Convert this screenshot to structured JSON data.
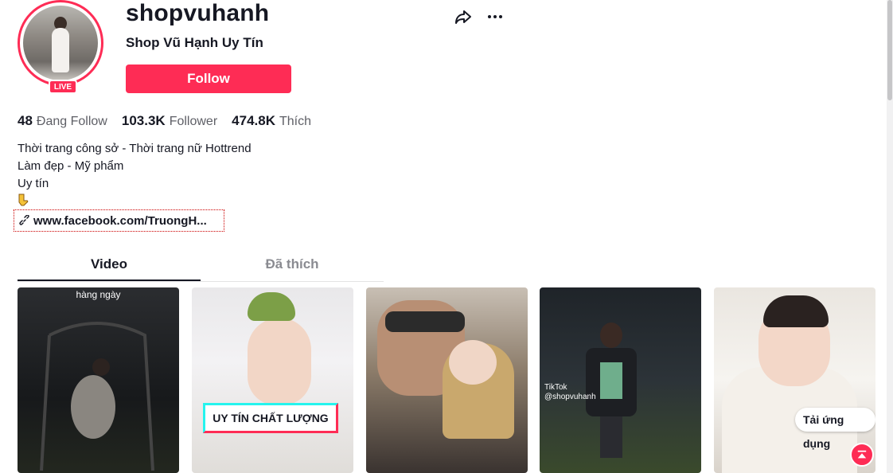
{
  "profile": {
    "username": "shopvuhanh",
    "display_name": "Shop Vũ Hạnh Uy Tín",
    "live_badge": "LIVE",
    "follow_label": "Follow"
  },
  "stats": [
    {
      "value": "48",
      "label": "Đang Follow"
    },
    {
      "value": "103.3K",
      "label": "Follower"
    },
    {
      "value": "474.8K",
      "label": "Thích"
    }
  ],
  "bio": {
    "line1": "Thời trang công sở - Thời trang nữ Hottrend",
    "line2": "Làm đẹp - Mỹ phẩm",
    "line3": "Uy tín"
  },
  "link": {
    "text": "www.facebook.com/TruongH..."
  },
  "tabs": {
    "video": "Video",
    "liked": "Đã thích"
  },
  "videos": [
    {
      "caption": "hàng ngày"
    },
    {
      "caption": "UY TÍN CHẤT LƯỢNG"
    },
    {
      "caption": ""
    },
    {
      "watermark_brand": "TikTok",
      "watermark_handle": "@shopvuhanh"
    },
    {
      "app_prompt": "Tải ứng dụng"
    }
  ],
  "colors": {
    "accent": "#fe2c55",
    "cyan": "#25f4ee",
    "text": "#161823",
    "muted": "#5e5f66"
  }
}
